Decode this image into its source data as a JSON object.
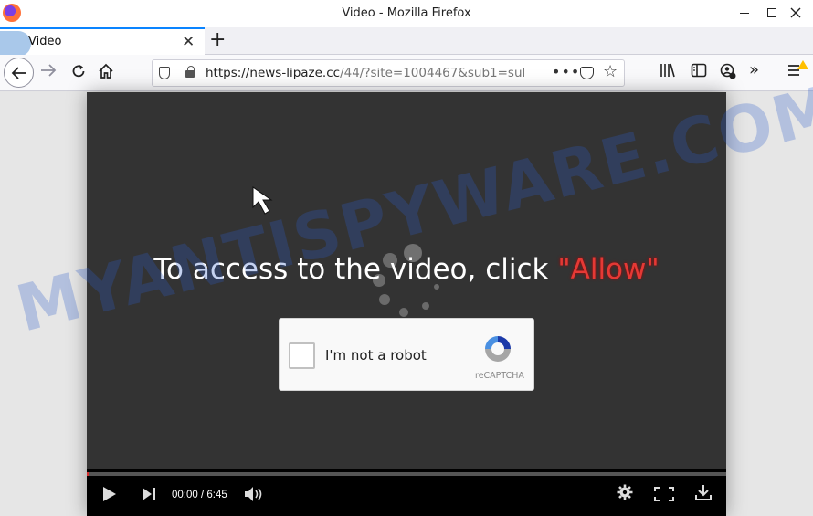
{
  "window": {
    "title": "Video - Mozilla Firefox",
    "buttons": {
      "minimize": "minimize",
      "maximize": "maximize",
      "close": "close"
    }
  },
  "tabs": [
    {
      "label": "Video",
      "active": true
    }
  ],
  "toolbar": {
    "url_host": "https://news-lipaze.cc",
    "url_rest": "/44/?site=1004467&sub1=sul",
    "page_actions_glyph": "•••"
  },
  "page": {
    "headline": "To access to the video, click ",
    "headline_highlight": "\"Allow\"",
    "captcha": {
      "label": "I'm not a robot",
      "brand": "reCAPTCHA"
    },
    "player": {
      "time": "00:00 / 6:45",
      "progress": 0.002
    }
  },
  "watermark": "MYANTISPYWARE.COM",
  "colors": {
    "accent": "#0a84ff",
    "allow_text": "#e53935",
    "player_bg": "#333333",
    "watermark": "#2d5fc8"
  },
  "icons": {
    "back": "back-arrow-icon",
    "forward": "forward-arrow-icon",
    "reload": "reload-icon",
    "home": "home-icon",
    "shield": "shield-icon",
    "lock": "lock-icon",
    "pocket": "pocket-icon",
    "bookmark": "star-icon",
    "library": "library-icon",
    "sidebar": "sidebar-icon",
    "account": "account-icon",
    "menu": "hamburger-menu-icon"
  }
}
